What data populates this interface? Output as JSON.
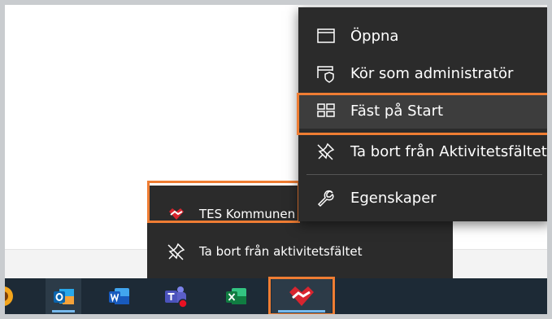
{
  "context_menu": {
    "items": [
      {
        "label": "Öppna",
        "icon": "window-icon"
      },
      {
        "label": "Kör som administratör",
        "icon": "shield-window-icon"
      },
      {
        "label": "Fäst på Start",
        "icon": "pin-to-start-icon"
      },
      {
        "label": "Ta bort från Aktivitetsfältet",
        "icon": "unpin-icon"
      },
      {
        "label": "Egenskaper",
        "icon": "wrench-icon"
      }
    ]
  },
  "jump_list": {
    "app_label": "TES Kommunen",
    "unpin_label": "Ta bort från aktivitetsfältet"
  },
  "taskbar": {
    "apps": [
      "sunflower-app-icon",
      "outlook-icon",
      "word-icon",
      "teams-icon",
      "excel-icon",
      "tes-kommunen-icon"
    ]
  },
  "colors": {
    "highlight_border": "#ef7d33",
    "menu_bg": "#2b2b2b",
    "taskbar_bg": "#1d2a36",
    "tes_red": "#d8252f"
  }
}
